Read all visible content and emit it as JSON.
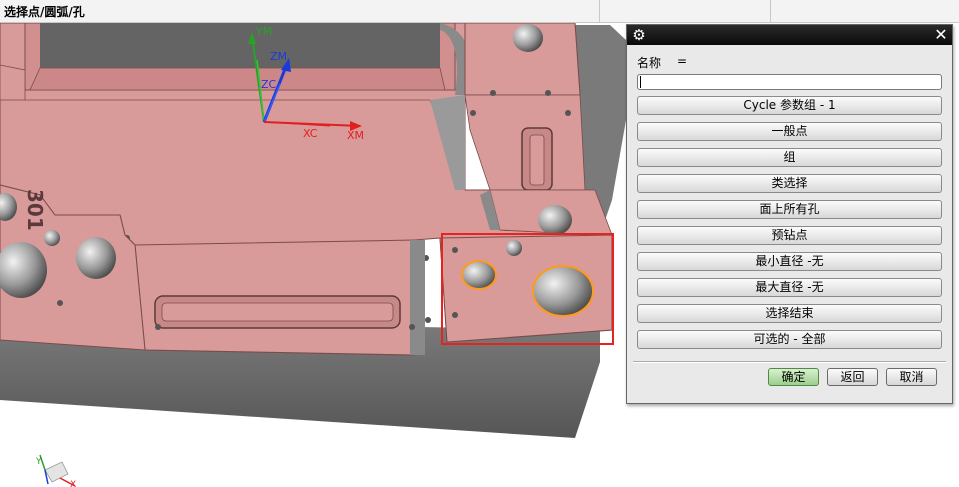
{
  "window": {
    "title": "选择点/圆弧/孔"
  },
  "viewport": {
    "axis_labels": {
      "yc": "YM",
      "zm": "ZM",
      "zc": "ZC",
      "xc": "XC",
      "xm": "XM"
    },
    "part_engraving": "301",
    "view_triad_labels": {
      "y": "Y",
      "x": "X"
    }
  },
  "dialog": {
    "name_label": "名称",
    "name_equals": "=",
    "name_value": "",
    "buttons": [
      "Cycle 参数组 - 1",
      "一般点",
      "组",
      "类选择",
      "面上所有孔",
      "预钻点",
      "最小直径 -无",
      "最大直径 -无",
      "选择结束",
      "可选的 - 全部"
    ],
    "footer": {
      "ok": "确定",
      "back": "返回",
      "cancel": "取消"
    }
  },
  "colors": {
    "part_face": "#d99a9a",
    "part_side": "#6a6a6a",
    "highlight_box": "#e8231e",
    "selected_hole_edge": "#ff9a1a",
    "title_bar": "#111111"
  }
}
